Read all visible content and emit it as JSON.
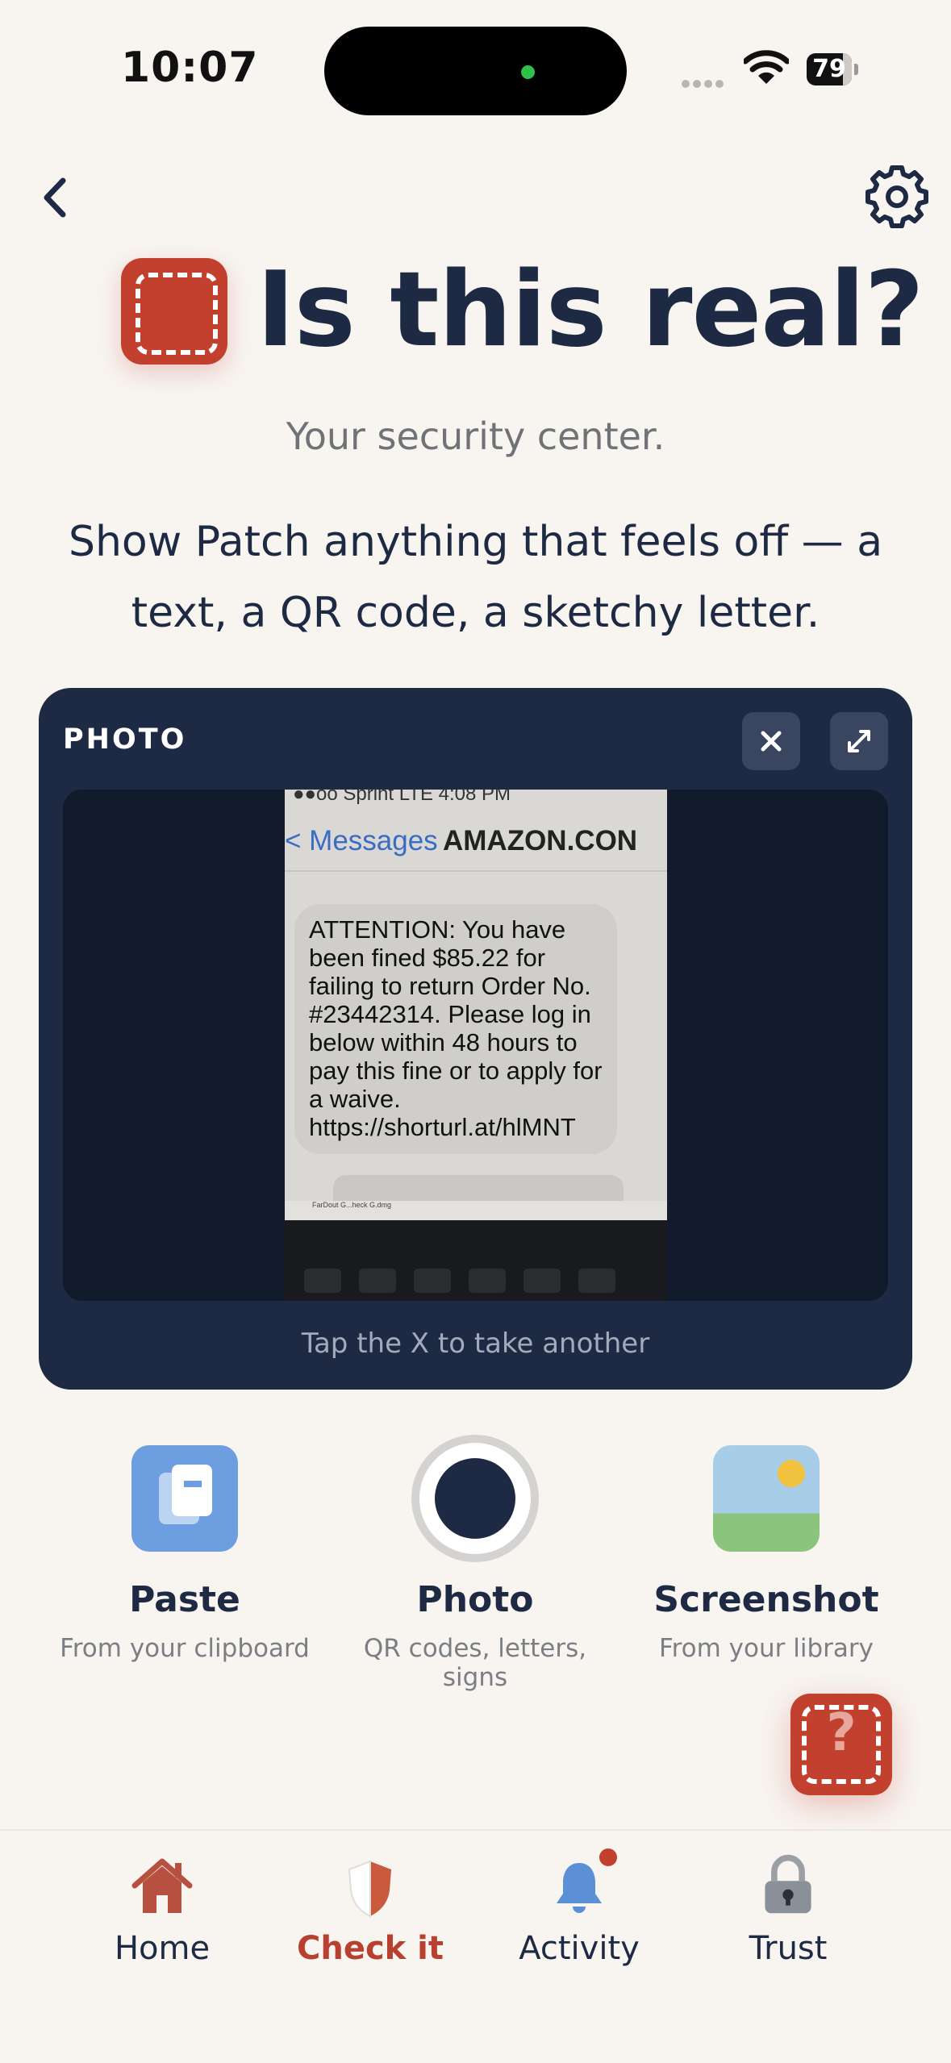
{
  "status_bar": {
    "time": "10:07",
    "battery": "79"
  },
  "header": {
    "title": "Is this real?",
    "subtitle": "Your security center.",
    "description": "Show Patch anything that feels off — a text, a QR code, a sketchy letter."
  },
  "photo_card": {
    "label": "PHOTO",
    "hint": "Tap the X to take another",
    "image": {
      "status": "●●oo Sprint  LTE          4:08 PM",
      "back": "< Messages",
      "sender": "AMAZON.CON",
      "message": "ATTENTION: You have been fined $85.22 for failing to return Order No. #23442314. Please log in below within 48 hours to pay this fine or to apply for a waive. https://shorturl.at/hlMNT",
      "file_label": "FarDout G...heck G.dmg"
    }
  },
  "actions": [
    {
      "title": "Paste",
      "subtitle": "From your clipboard"
    },
    {
      "title": "Photo",
      "subtitle": "QR codes, letters, signs"
    },
    {
      "title": "Screenshot",
      "subtitle": "From your library"
    }
  ],
  "help_button": {
    "symbol": "?"
  },
  "tabs": [
    {
      "label": "Home",
      "icon": "house-icon"
    },
    {
      "label": "Check it",
      "icon": "shield-icon",
      "active": true
    },
    {
      "label": "Activity",
      "icon": "bell-icon"
    },
    {
      "label": "Trust",
      "icon": "padlock-icon"
    }
  ],
  "colors": {
    "brand": "#c2402e",
    "navy": "#1e2a44",
    "background": "#f8f5f1",
    "accent_blue": "#6c9ee0"
  }
}
